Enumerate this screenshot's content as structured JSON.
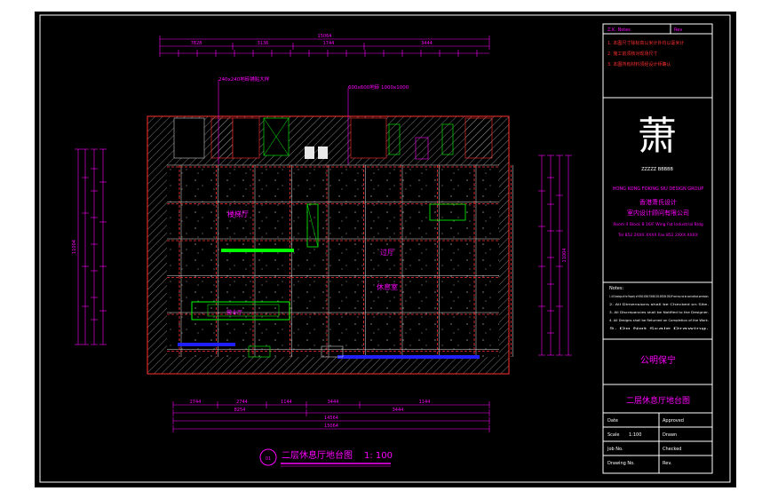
{
  "drawing": {
    "title": "二层休息厅地台图",
    "scale": "1: 100",
    "room_labels": [
      "楼梯厅",
      "过厅",
      "休息室",
      "营业厅"
    ],
    "callouts": [
      "240x240地砖铺贴大样",
      "600x600地砖 1000x1000"
    ]
  },
  "dimensions": {
    "top_total": "15064",
    "top_row2": [
      "7828",
      "3136",
      "1744",
      "3444"
    ],
    "bottom_row1": [
      "2744",
      "2744",
      "1144",
      "3444",
      "1144"
    ],
    "bottom_row2": [
      "8254",
      "3444"
    ],
    "bottom_row3": [
      "14564"
    ],
    "bottom_total": "15064",
    "left_total": "11004",
    "right_total": "11004"
  },
  "title_block": {
    "top_left_label": "Z.K. Notes",
    "top_right_label": "Rev",
    "notes": [
      "1. 本图尺寸除标高以米计外均以毫米计",
      "2. 施工前须核对现场尺寸",
      "3. 本图所有材料须经设计师确认"
    ],
    "logo_char": "萧",
    "logo_sub": "ZZZZZ BBBBB",
    "company_en": "HONG KONG FOKING SIU DESIGN GROUP",
    "company_cn_lines": [
      "香港萧氏设计",
      "室内设计顾问有限公司",
      "Room 4 Block B 16/F Wing Fat Industrial Bldg",
      "Tel 852 2XXX XXXX   Fax 852 2XXX XXXX"
    ],
    "notes_header": "Notes:",
    "notes_en": [
      "1. All Drawings of the Property of HONG KONG FOKING SIU DESIGN GROUP and may not be used without permission.",
      "2. All Dimensions shall be Checked on Site.",
      "3. All Discrepancies shall be Notified to the Designer.",
      "4. All Designs shall be Returned on Completion of the Work.",
      "5. Do Not Scale Drawing."
    ],
    "project_name": "公明保宁",
    "drawing_title": "二层休息厅地台图",
    "fields": [
      {
        "label": "Date",
        "value": "",
        "label2": "Approved",
        "value2": ""
      },
      {
        "label": "Scale",
        "value": "1:100",
        "label2": "Drawn",
        "value2": ""
      },
      {
        "label": "Job No.",
        "value": "",
        "label2": "Checked",
        "value2": ""
      },
      {
        "label": "Drawing No.",
        "value": "",
        "label2": "Rev.",
        "value2": ""
      }
    ]
  },
  "colors": {
    "background": "#000000",
    "border": "#ffffff",
    "dimension": "#ff00ff",
    "wall": "#ff3030",
    "tile_line": "#ffffff",
    "hatch": "#c8c8c8",
    "fixture": "#00ff00",
    "bench": "#0000ff",
    "titleblock_text": "#ff00ff"
  }
}
